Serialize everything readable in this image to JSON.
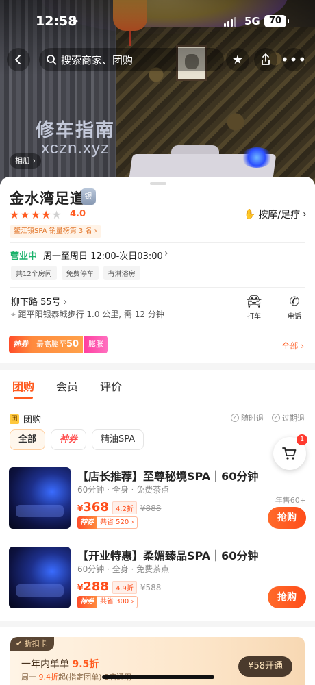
{
  "status_bar": {
    "time": "12:58",
    "network": "5G",
    "battery": "70"
  },
  "watermark": {
    "line1": "修车指南",
    "line2": "xczn.xyz"
  },
  "nav": {
    "search_placeholder": "搜索商家、团购"
  },
  "hero": {
    "album_label": "相册"
  },
  "shop": {
    "name": "金水湾足道",
    "medal": "银",
    "rating": 4.0,
    "rating_text": "4.0",
    "category": "按摩/足疗",
    "rank": "鳌江镇SPA 销量榜第 3 名",
    "open_status": "营业中",
    "hours": "周一至周日 12:00-次日03:00",
    "tags": [
      "共12个房间",
      "免费停车",
      "有淋浴房"
    ],
    "address": "柳下路 55号",
    "distance": "距平阳银泰城步行 1.0 公里, 需 12 分钟",
    "actions": {
      "taxi": "打车",
      "phone": "电话"
    }
  },
  "promo_bar": {
    "badge": "神券",
    "text_prefix": "最高膨至",
    "amount": "50",
    "inflate": "膨胀",
    "all": "全部"
  },
  "tabs": [
    "团购",
    "会员",
    "评价"
  ],
  "group": {
    "label": "团购",
    "guarantees": [
      "随时退",
      "过期退"
    ],
    "filters": [
      "全部",
      "神券",
      "精油SPA"
    ],
    "cart_count": "1"
  },
  "deals": [
    {
      "title": "【店长推荐】至尊秘境SPA｜60分钟",
      "subtitle": "60分钟 · 全身 · 免费茶点",
      "currency": "¥",
      "price": "368",
      "discount": "4.2折",
      "original": "¥888",
      "save_badge": "神券",
      "save_text": "共省 520",
      "yearly": "年售60+",
      "buy": "抢购"
    },
    {
      "title": "【开业特惠】柔媚臻品SPA｜60分钟",
      "subtitle": "60分钟 · 全身 · 免费茶点",
      "currency": "¥",
      "price": "288",
      "discount": "4.9折",
      "original": "¥588",
      "save_badge": "神券",
      "save_text": "共省 300",
      "buy": "抢购"
    }
  ],
  "card_promo": {
    "tag": "折扣卡",
    "title_prefix": "一年内单单",
    "title_highlight": "9.5折",
    "sub_prefix": "周一",
    "sub_highlight": "9.4折",
    "sub_suffix": "起(指定团单)·2店通用",
    "button": "¥58开通"
  },
  "colors": {
    "accent": "#ff5a1f",
    "open_green": "#1ab26b",
    "sheen_pink": "#ff3fa0"
  },
  "icons": [
    "back-icon",
    "search-icon",
    "star-icon",
    "share-icon",
    "more-icon",
    "taxi-icon",
    "phone-icon",
    "location-icon",
    "cart-icon"
  ]
}
